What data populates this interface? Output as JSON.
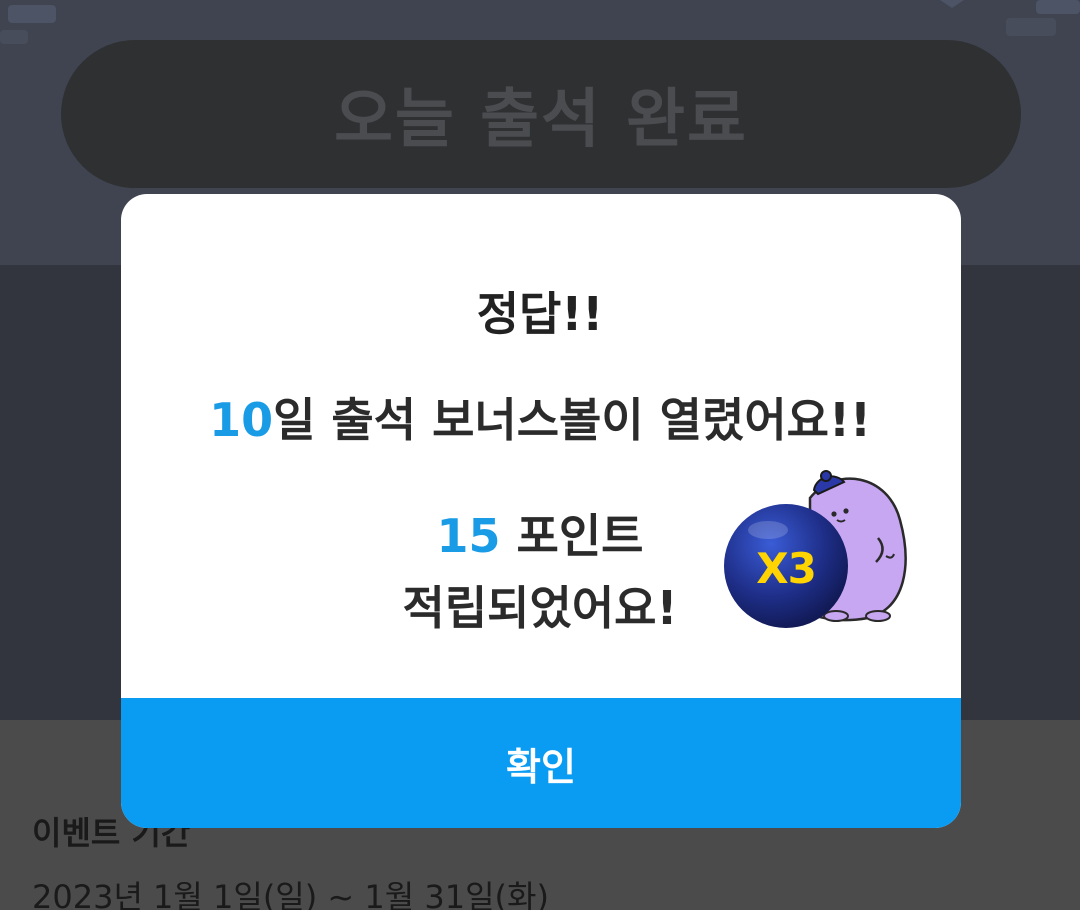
{
  "background": {
    "attend_button_label": "오늘 출석 완료",
    "event_period_title": "이벤트 기간",
    "event_period_dates": "2023년 1월 1일(일) ~ 1월 31일(화)"
  },
  "modal": {
    "title": "정답!!",
    "bonus_days": "10",
    "bonus_text": "일 출석 보너스볼이 열렸어요!!",
    "points_value": "15",
    "points_unit": " 포인트",
    "saved_text": "적립되었어요!",
    "ball_label": "X3",
    "confirm_label": "확인"
  },
  "colors": {
    "accent_blue": "#1a9be6",
    "button_blue": "#0a9cf2",
    "ball_navy": "#1f2f8a",
    "ball_text": "#ffd400",
    "mascot_purple": "#c7a6f2",
    "dim_overlay": "#32353d"
  },
  "icons": {
    "bonus_ball": "bonus-ball-icon",
    "mascot": "mascot-character-icon"
  }
}
